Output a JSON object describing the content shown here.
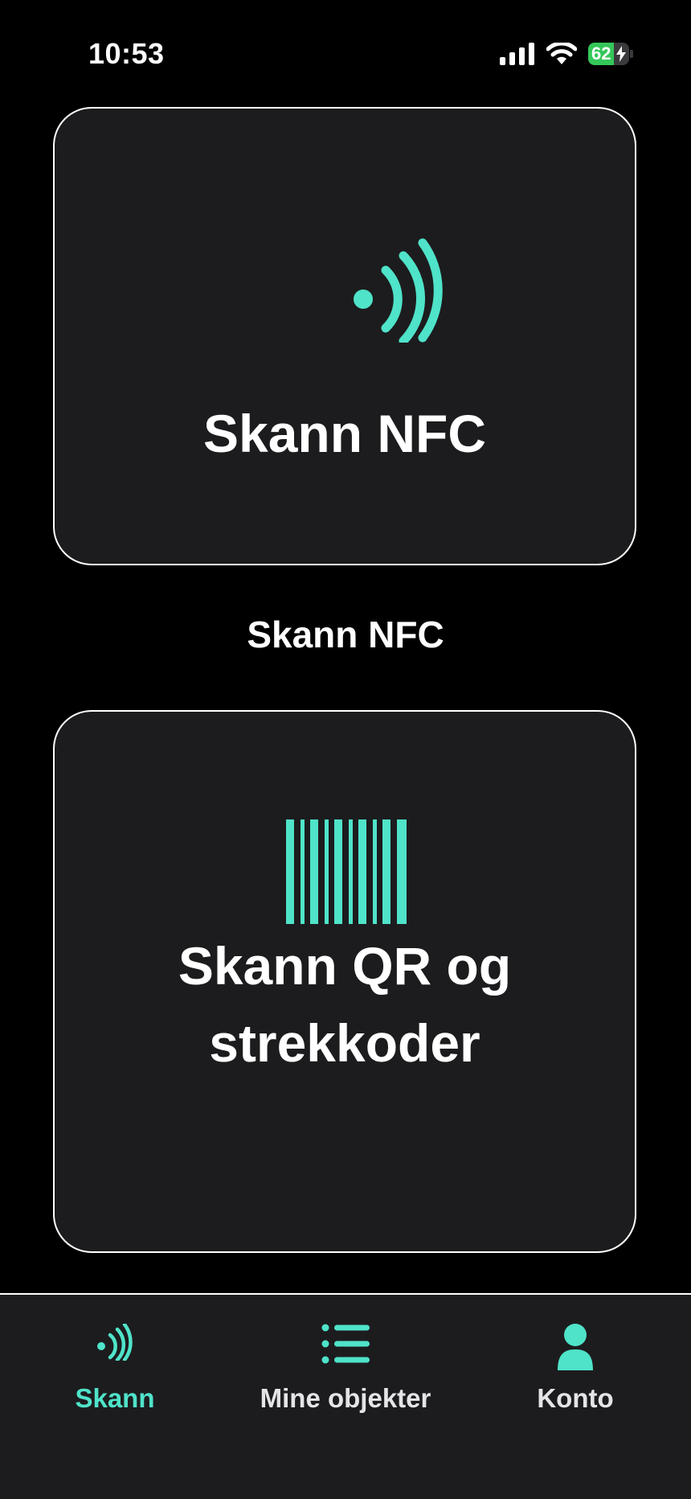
{
  "status_bar": {
    "time": "10:53",
    "battery_percent": "62",
    "battery_level": 0.62,
    "battery_charging": true,
    "icons": [
      "cellular-signal-icon",
      "wifi-icon",
      "battery-icon"
    ]
  },
  "colors": {
    "accent": "#4fe3c9",
    "background": "#000000",
    "card": "#1c1c1e",
    "battery_green": "#34c759"
  },
  "cards": {
    "nfc": {
      "icon": "nfc-icon",
      "title": "Skann NFC"
    },
    "qr": {
      "icon": "barcode-icon",
      "title_line1": "Skann QR og",
      "title_line2": "strekkoder"
    }
  },
  "caption": "Skann NFC",
  "tab_bar": {
    "active": "skann",
    "tabs": [
      {
        "id": "skann",
        "label": "Skann",
        "icon": "nfc-icon"
      },
      {
        "id": "mine_objekter",
        "label": "Mine objekter",
        "icon": "list-icon"
      },
      {
        "id": "konto",
        "label": "Konto",
        "icon": "person-icon"
      }
    ]
  }
}
